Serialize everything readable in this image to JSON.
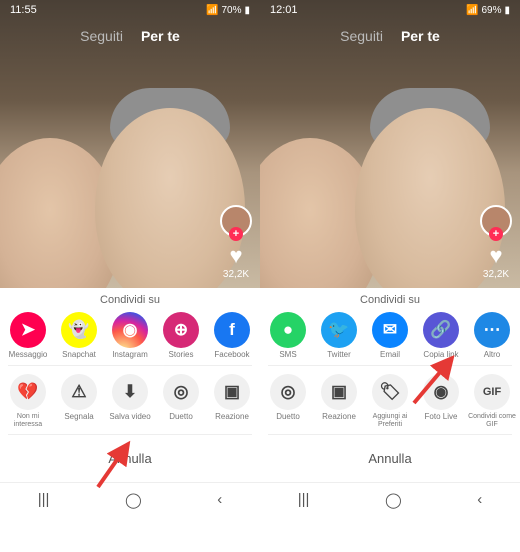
{
  "left": {
    "status": {
      "time": "11:55",
      "battery": "70%"
    },
    "tabs": {
      "inactive": "Seguiti",
      "active": "Per te"
    },
    "like_count": "32,2K",
    "share_title": "Condividi su",
    "row1": [
      {
        "name": "messaggio",
        "label": "Messaggio",
        "glyph": "➤",
        "cls": "c-msg"
      },
      {
        "name": "snapchat",
        "label": "Snapchat",
        "glyph": "👻",
        "cls": "c-snap"
      },
      {
        "name": "instagram",
        "label": "Instagram",
        "glyph": "◉",
        "cls": "c-ig"
      },
      {
        "name": "stories",
        "label": "Stories",
        "glyph": "⊕",
        "cls": "c-stories"
      },
      {
        "name": "facebook",
        "label": "Facebook",
        "glyph": "f",
        "cls": "c-fb"
      }
    ],
    "row2": [
      {
        "name": "non-mi-interessa",
        "label": "Non mi interessa",
        "glyph": "💔"
      },
      {
        "name": "segnala",
        "label": "Segnala",
        "glyph": "⚠"
      },
      {
        "name": "salva-video",
        "label": "Salva video",
        "glyph": "⬇"
      },
      {
        "name": "duetto",
        "label": "Duetto",
        "glyph": "◎"
      },
      {
        "name": "reazione",
        "label": "Reazione",
        "glyph": "▣"
      }
    ],
    "cancel": "Annulla"
  },
  "right": {
    "status": {
      "time": "12:01",
      "battery": "69%"
    },
    "tabs": {
      "inactive": "Seguiti",
      "active": "Per te"
    },
    "like_count": "32,2K",
    "share_title": "Condividi su",
    "row1": [
      {
        "name": "sms",
        "label": "SMS",
        "glyph": "●",
        "cls": "c-sms"
      },
      {
        "name": "twitter",
        "label": "Twitter",
        "glyph": "🐦",
        "cls": "c-tw"
      },
      {
        "name": "email",
        "label": "Email",
        "glyph": "✉",
        "cls": "c-mail"
      },
      {
        "name": "copia-link",
        "label": "Copia link",
        "glyph": "🔗",
        "cls": "c-link"
      },
      {
        "name": "altro",
        "label": "Altro",
        "glyph": "⋯",
        "cls": "c-more"
      }
    ],
    "row2": [
      {
        "name": "duetto2",
        "label": "Duetto",
        "glyph": "◎"
      },
      {
        "name": "reazione2",
        "label": "Reazione",
        "glyph": "▣"
      },
      {
        "name": "preferiti",
        "label": "Aggiungi ai Preferiti",
        "glyph": "🏷"
      },
      {
        "name": "foto-live",
        "label": "Foto Live",
        "glyph": "◉"
      },
      {
        "name": "gif",
        "label": "Condividi come GIF",
        "glyph": "GIF"
      }
    ],
    "cancel": "Annulla"
  },
  "nav": {
    "recents": "|||",
    "home": "◯",
    "back": "‹"
  }
}
